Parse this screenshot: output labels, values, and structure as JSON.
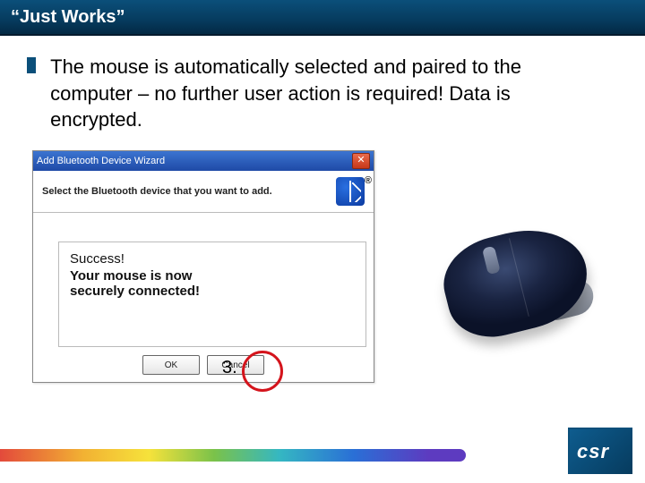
{
  "title": "“Just Works”",
  "bullet": "The mouse is automatically selected and paired to the computer – no further user action is required!  Data is encrypted.",
  "wizard": {
    "title": "Add Bluetooth Device Wizard",
    "instruction": "Select the Bluetooth device that you want to add.",
    "message": {
      "line1": "Success!",
      "line2": "Your mouse is now",
      "line3": "securely connected!"
    },
    "ok_label": "OK",
    "cancel_label": "Cancel",
    "close_glyph": "✕"
  },
  "step_label": "3.",
  "footer_logo": "csr",
  "bt_trademark": "®"
}
